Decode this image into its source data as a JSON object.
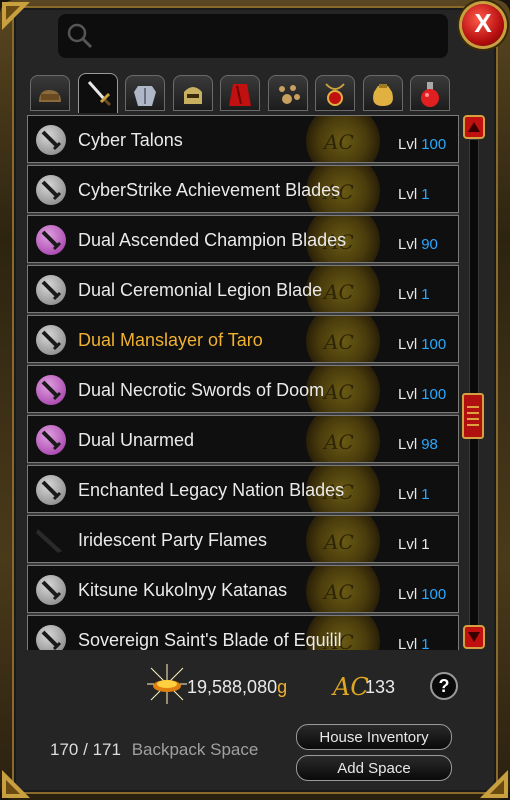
{
  "search": {
    "placeholder": ""
  },
  "close_label": "X",
  "tabs": [
    {
      "name": "bag-icon"
    },
    {
      "name": "sword-icon",
      "active": true
    },
    {
      "name": "armor-icon"
    },
    {
      "name": "helm-icon"
    },
    {
      "name": "cape-icon"
    },
    {
      "name": "pet-icon"
    },
    {
      "name": "amulet-icon"
    },
    {
      "name": "item-bag-icon"
    },
    {
      "name": "potion-icon"
    }
  ],
  "items": [
    {
      "name": "Cyber Talons",
      "icon": "gray",
      "lvl_label": "Lvl",
      "lvl": "100",
      "lvl_color": "blue"
    },
    {
      "name": "CyberStrike Achievement Blades",
      "icon": "gray",
      "lvl_label": "Lvl",
      "lvl": "1",
      "lvl_color": "blue"
    },
    {
      "name": "Dual Ascended Champion Blades",
      "icon": "purple",
      "lvl_label": "Lvl",
      "lvl": "90",
      "lvl_color": "blue"
    },
    {
      "name": "Dual Ceremonial Legion Blade",
      "icon": "gray",
      "lvl_label": "Lvl",
      "lvl": "1",
      "lvl_color": "blue"
    },
    {
      "name": "Dual Manslayer of Taro",
      "icon": "gray",
      "lvl_label": "Lvl",
      "lvl": "100",
      "lvl_color": "blue",
      "gold": true
    },
    {
      "name": "Dual Necrotic Swords of Doom",
      "icon": "purple",
      "lvl_label": "Lvl",
      "lvl": "100",
      "lvl_color": "blue"
    },
    {
      "name": "Dual Unarmed",
      "icon": "purple",
      "lvl_label": "Lvl",
      "lvl": "98",
      "lvl_color": "blue"
    },
    {
      "name": "Enchanted Legacy Nation Blades",
      "icon": "gray",
      "lvl_label": "Lvl",
      "lvl": "1",
      "lvl_color": "blue"
    },
    {
      "name": "Iridescent Party Flames",
      "icon": "dark",
      "lvl_label": "Lvl",
      "lvl": "1",
      "lvl_color": "white"
    },
    {
      "name": "Kitsune Kukolnyy Katanas",
      "icon": "gray",
      "lvl_label": "Lvl",
      "lvl": "100",
      "lvl_color": "blue"
    },
    {
      "name": "Sovereign Saint's Blade of Equilil",
      "icon": "gray",
      "lvl_label": "Lvl",
      "lvl": "1",
      "lvl_color": "blue"
    }
  ],
  "medal_text": "AC",
  "gold": {
    "value": "19,588,080",
    "suffix": "g"
  },
  "ac": {
    "symbol": "AC",
    "value": "133"
  },
  "help_label": "?",
  "backpack": {
    "used": "170",
    "sep": "/",
    "total": "171",
    "label": "Backpack Space"
  },
  "buttons": {
    "house": "House Inventory",
    "add": "Add Space"
  },
  "colors": {
    "gold_text": "#f0b030",
    "level_blue": "#2aa8ff",
    "accent_red": "#c01010"
  }
}
